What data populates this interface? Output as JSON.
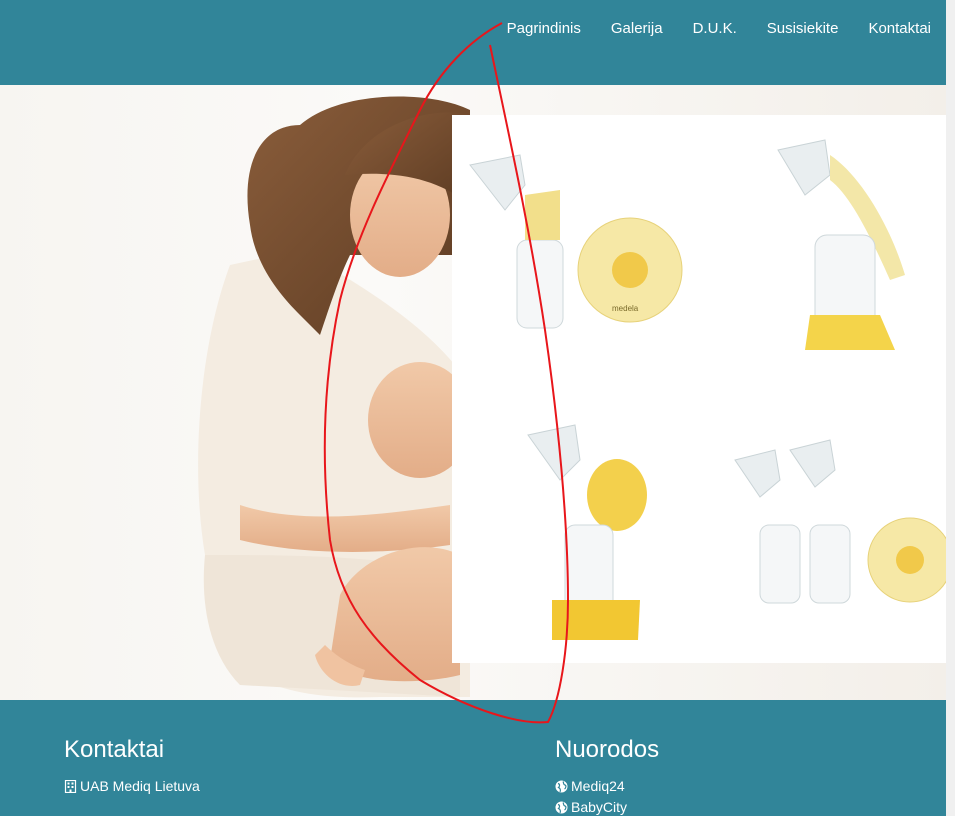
{
  "nav": {
    "items": [
      "Pagrindinis",
      "Galerija",
      "D.U.K.",
      "Susisiekite",
      "Kontaktai"
    ]
  },
  "hero": {
    "product_brand": "medela"
  },
  "footer": {
    "contacts_heading": "Kontaktai",
    "company": "UAB Mediq Lietuva",
    "links_heading": "Nuorodos",
    "links": [
      "Mediq24",
      "BabyCity"
    ]
  },
  "colors": {
    "brand_teal": "#318599",
    "annotation_red": "#e8161b"
  }
}
